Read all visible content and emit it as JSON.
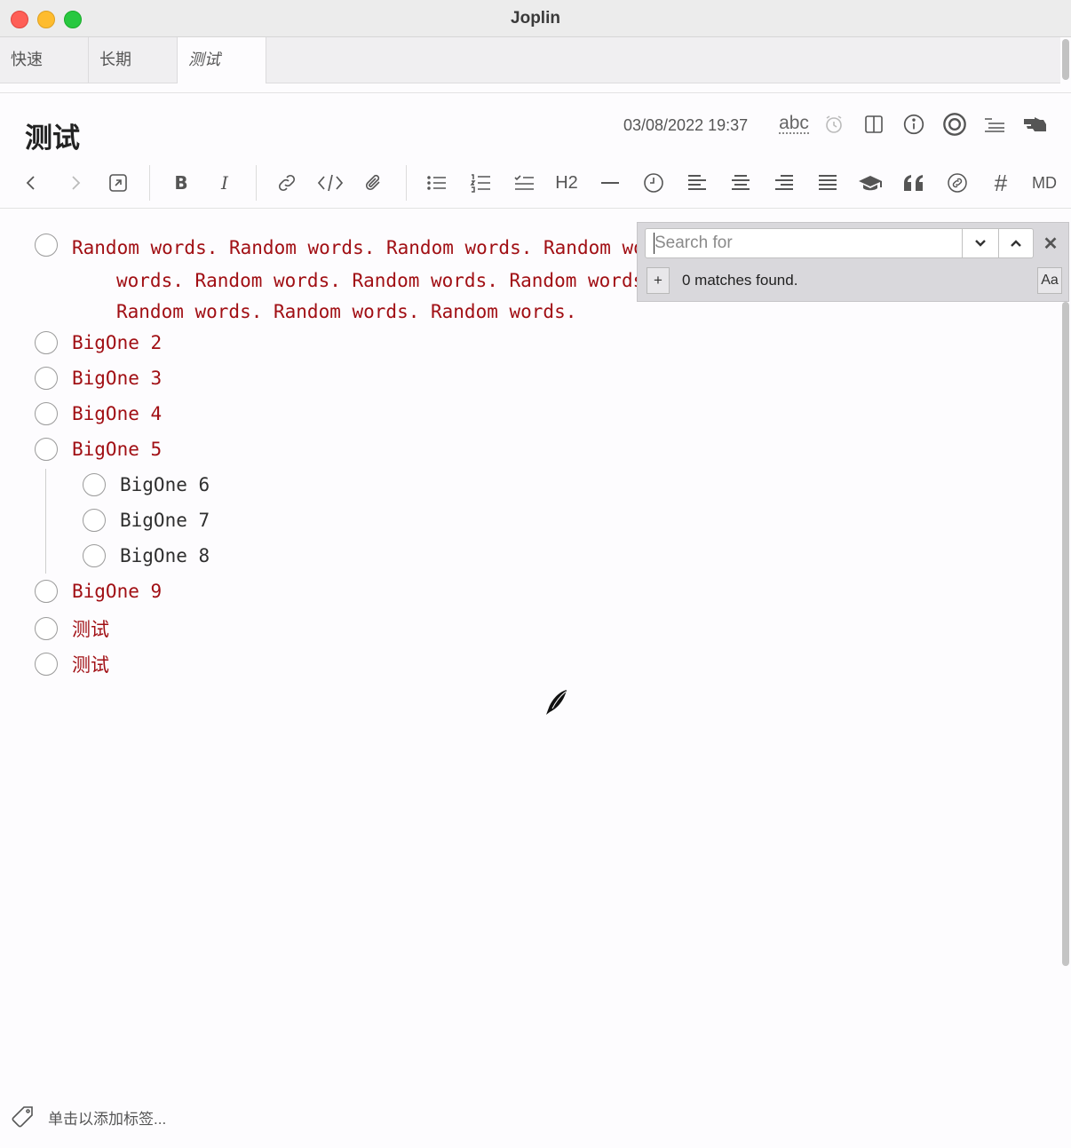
{
  "window": {
    "title": "Joplin"
  },
  "tabs": [
    {
      "label": "快速",
      "active": false
    },
    {
      "label": "长期",
      "active": false
    },
    {
      "label": "测试",
      "active": true
    }
  ],
  "note": {
    "title": "测试",
    "date": "03/08/2022 19:37",
    "spellcheck_label": "abc"
  },
  "toolbar": {
    "heading_label": "H2",
    "markdown_label": "MD",
    "tag_symbol": "#"
  },
  "checklist": {
    "long_item_lines": [
      "Random words. Random words. Random words. Random words. Random",
      "words. Random words. Random words. Random words. Random words.",
      "Random words. Random words. Random words."
    ],
    "items": [
      {
        "text": "BigOne 2",
        "checked": false
      },
      {
        "text": "BigOne 3",
        "checked": false
      },
      {
        "text": "BigOne 4",
        "checked": false
      },
      {
        "text": "BigOne 5",
        "checked": false
      },
      {
        "text": "BigOne 6",
        "checked": false
      },
      {
        "text": "BigOne 7",
        "checked": false
      },
      {
        "text": "BigOne 8",
        "checked": false
      },
      {
        "text": "BigOne 9",
        "checked": false
      },
      {
        "text": "测试",
        "checked": false
      },
      {
        "text": "测试",
        "checked": false
      }
    ]
  },
  "search": {
    "placeholder": "Search for",
    "value": "",
    "matches_text": "0 matches found.",
    "plus_label": "+",
    "case_label": "Aa",
    "close_label": "✕"
  },
  "footer": {
    "tag_placeholder": "单击以添加标签..."
  },
  "colors": {
    "item_red": "#a10f14",
    "item_dark": "#2f2f2f",
    "search_bg": "#d9d8dc"
  }
}
